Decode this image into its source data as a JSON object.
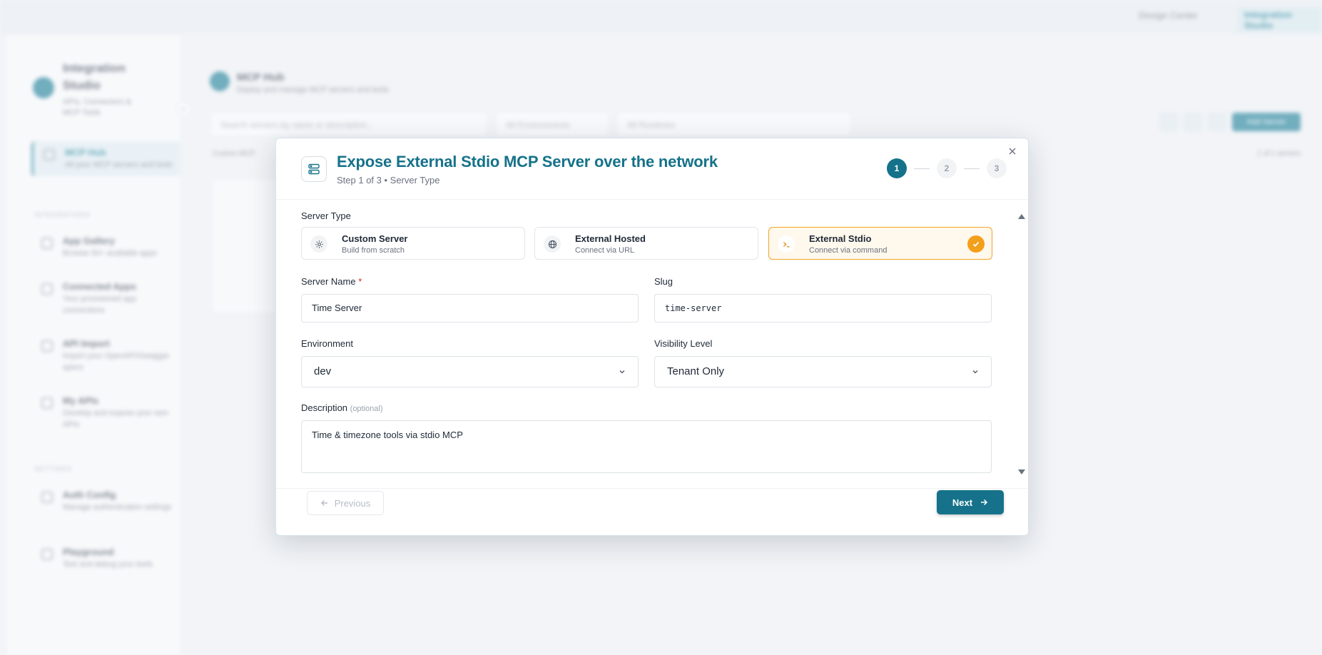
{
  "background": {
    "breadcrumb": [
      "Design Center",
      "Integration Studio"
    ],
    "brand": {
      "title": "Integration Studio",
      "subtitle": "APIs, Connectors & MCP Tools"
    },
    "sidebar": {
      "active_item": {
        "title": "MCP Hub",
        "subtitle": "All your MCP servers and tools"
      },
      "section_integrations": "INTEGRATIONS",
      "items": [
        {
          "title": "App Gallery",
          "subtitle": "Browse 50+ available apps"
        },
        {
          "title": "Connected Apps",
          "subtitle": "Your provisioned app connections"
        },
        {
          "title": "API Import",
          "subtitle": "Import your OpenAPI/Swagger specs"
        },
        {
          "title": "My APIs",
          "subtitle": "Develop and expose your own APIs"
        }
      ],
      "section_settings": "SETTINGS",
      "settings_items": [
        {
          "title": "Auth Config",
          "subtitle": "Manage authentication settings"
        },
        {
          "title": "Playground",
          "subtitle": "Test and debug your tools"
        }
      ]
    },
    "hub": {
      "title": "MCP Hub",
      "subtitle": "Deploy and manage MCP servers and tools",
      "search_placeholder": "Search servers by name or description...",
      "env_filter": "All Environments",
      "runtime_filter": "All Runtimes",
      "add_button": "Add Server",
      "list_label": "Custom MCP",
      "count_label": "1 of 1 servers"
    }
  },
  "modal": {
    "title": "Expose External Stdio MCP Server over the network",
    "subtitle": "Step 1 of 3 • Server Type",
    "steps": [
      "1",
      "2",
      "3"
    ],
    "server_type_label": "Server Type",
    "server_types": [
      {
        "title": "Custom Server",
        "subtitle": "Build from scratch",
        "icon": "gear-icon",
        "selected": false
      },
      {
        "title": "External Hosted",
        "subtitle": "Connect via URL",
        "icon": "globe-icon",
        "selected": false
      },
      {
        "title": "External Stdio",
        "subtitle": "Connect via command",
        "icon": "terminal-icon",
        "selected": true
      }
    ],
    "server_name_label": "Server Name",
    "required_mark": "*",
    "server_name_value": "Time Server",
    "slug_label": "Slug",
    "slug_value": "time-server",
    "environment_label": "Environment",
    "environment_value": "dev",
    "visibility_label": "Visibility Level",
    "visibility_value": "Tenant Only",
    "description_label": "Description",
    "optional_label": "(optional)",
    "description_value": "Time & timezone tools via stdio MCP",
    "previous_label": "Previous",
    "next_label": "Next"
  },
  "colors": {
    "primary": "#15728a",
    "selected_border": "#f0a426",
    "selected_bg": "#fff8ec",
    "check": "#f2a01b",
    "required": "#dc2626"
  }
}
